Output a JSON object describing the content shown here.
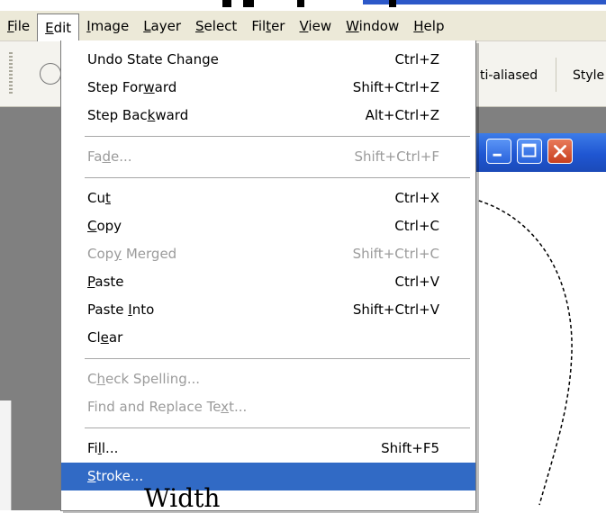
{
  "menubar": {
    "items": [
      {
        "label": "File",
        "u": "F",
        "rest": "ile"
      },
      {
        "label": "Edit",
        "u": "E",
        "rest": "dit"
      },
      {
        "label": "Image",
        "u": "I",
        "rest": "mage"
      },
      {
        "label": "Layer",
        "u": "L",
        "rest": "ayer"
      },
      {
        "label": "Select",
        "u": "S",
        "rest": "elect"
      },
      {
        "label": "Filter",
        "pre": "Fil",
        "u": "t",
        "rest": "er"
      },
      {
        "label": "View",
        "u": "V",
        "rest": "iew"
      },
      {
        "label": "Window",
        "u": "W",
        "rest": "indow"
      },
      {
        "label": "Help",
        "u": "H",
        "rest": "elp"
      }
    ]
  },
  "toolbar": {
    "antialiased_label": "ti-aliased",
    "style_label": "Style"
  },
  "edit_menu": {
    "undo": {
      "label": "Undo State Change",
      "shortcut": "Ctrl+Z"
    },
    "step_forward": {
      "pre": "Step For",
      "u": "w",
      "rest": "ard",
      "shortcut": "Shift+Ctrl+Z"
    },
    "step_backward": {
      "pre": "Step Bac",
      "u": "k",
      "rest": "ward",
      "shortcut": "Alt+Ctrl+Z"
    },
    "fade": {
      "pre": "Fa",
      "u": "d",
      "rest": "e...",
      "shortcut": "Shift+Ctrl+F"
    },
    "cut": {
      "pre": "Cu",
      "u": "t",
      "rest": "",
      "shortcut": "Ctrl+X"
    },
    "copy": {
      "pre": "",
      "u": "C",
      "rest": "opy",
      "shortcut": "Ctrl+C"
    },
    "copy_merged": {
      "pre": "Cop",
      "u": "y",
      "rest": " Merged",
      "shortcut": "Shift+Ctrl+C"
    },
    "paste": {
      "pre": "",
      "u": "P",
      "rest": "aste",
      "shortcut": "Ctrl+V"
    },
    "paste_into": {
      "pre": "Paste ",
      "u": "I",
      "rest": "nto",
      "shortcut": "Shift+Ctrl+V"
    },
    "clear": {
      "pre": "Cl",
      "u": "e",
      "rest": "ar"
    },
    "check_spelling": {
      "pre": "C",
      "u": "h",
      "rest": "eck Spelling..."
    },
    "find_replace": {
      "pre": "Find and Replace Te",
      "u": "x",
      "rest": "t..."
    },
    "fill": {
      "pre": "Fi",
      "u": "l",
      "rest": "l...",
      "shortcut": "Shift+F5"
    },
    "stroke": {
      "pre": "",
      "u": "S",
      "rest": "troke..."
    }
  },
  "overlay": {
    "text": "Width"
  },
  "colors": {
    "highlight": "#316ac5",
    "menubar": "#ece9d8",
    "titlebar": "#1f56d2",
    "workspace": "#808080"
  }
}
